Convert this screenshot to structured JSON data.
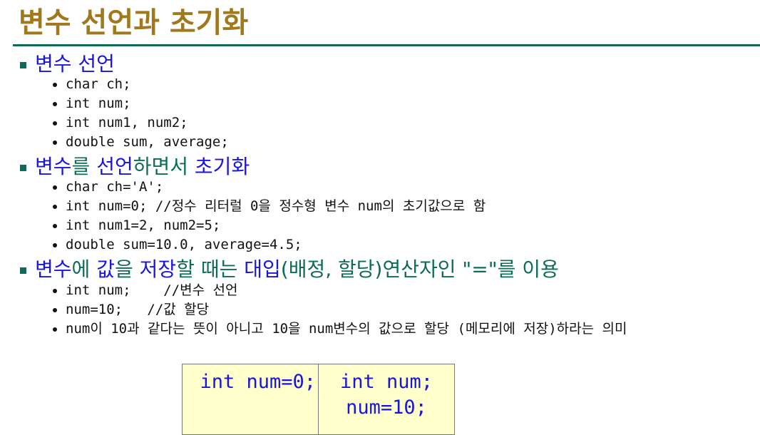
{
  "title": "변수 선언과 초기화",
  "sections": [
    {
      "parts": [
        {
          "text": "변수 선언",
          "color": "blue"
        }
      ],
      "items": [
        "char ch;",
        "int num;",
        "int num1, num2;",
        "double sum, average;"
      ]
    },
    {
      "parts": [
        {
          "text": "변수",
          "color": "blue"
        },
        {
          "text": "를 ",
          "color": "green"
        },
        {
          "text": "선언",
          "color": "blue"
        },
        {
          "text": "하면서 ",
          "color": "green"
        },
        {
          "text": "초기화",
          "color": "blue"
        }
      ],
      "items": [
        "char ch='A';",
        "int num=0; //정수 리터럴 0을 정수형 변수 num의 초기값으로 함",
        "int num1=2, num2=5;",
        "double sum=10.0, average=4.5;"
      ]
    },
    {
      "parts": [
        {
          "text": "변수",
          "color": "blue"
        },
        {
          "text": "에 ",
          "color": "green"
        },
        {
          "text": "값",
          "color": "blue"
        },
        {
          "text": "을 ",
          "color": "green"
        },
        {
          "text": "저장",
          "color": "blue"
        },
        {
          "text": "할 때는 ",
          "color": "green"
        },
        {
          "text": "대입",
          "color": "blue"
        },
        {
          "text": "(배정, 할당)연산자인 \"=\"를 이용",
          "color": "green"
        }
      ],
      "items": [
        "int num;    //변수 선언",
        "num=10;   //값 할당",
        "num이 10과 같다는 뜻이 아니고 10을 num변수의 값으로 할당 (메모리에 저장)하라는 의미"
      ]
    }
  ],
  "code_box": {
    "left": "int num=0;",
    "right_line1": "int num;",
    "right_line2": "num=10;"
  },
  "colors": {
    "title": "#a0791c",
    "accent": "#0e6b57",
    "blue": "#1a14e0"
  }
}
